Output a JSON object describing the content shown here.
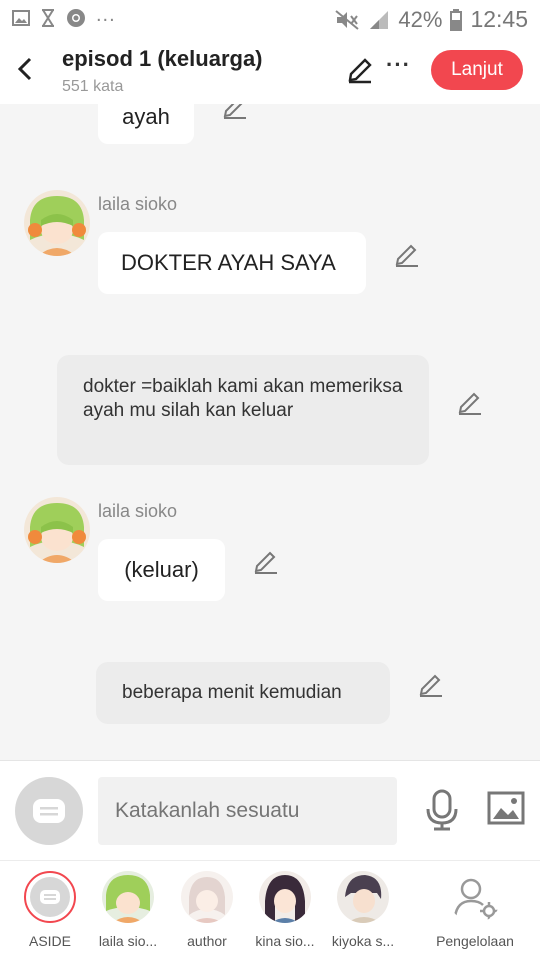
{
  "status_bar": {
    "battery": "42%",
    "time": "12:45",
    "more": "..."
  },
  "header": {
    "title": "episod 1 (keluarga)",
    "subtitle": "551 kata",
    "more": "···",
    "next_label": "Lanjut"
  },
  "messages": [
    {
      "type": "bubble",
      "text": "ayah"
    },
    {
      "type": "character",
      "name": "laila sioko",
      "text": "DOKTER AYAH SAYA"
    },
    {
      "type": "narration",
      "text": "dokter =baiklah kami akan memeriksa ayah mu silah kan keluar"
    },
    {
      "type": "character",
      "name": "laila sioko",
      "text": "(keluar)"
    },
    {
      "type": "narration",
      "text": "beberapa menit kemudian"
    }
  ],
  "input": {
    "placeholder": "Katakanlah sesuatu"
  },
  "cast": [
    {
      "label": "ASIDE"
    },
    {
      "label": "laila sio..."
    },
    {
      "label": "author"
    },
    {
      "label": "kina sio..."
    },
    {
      "label": "kiyoka s..."
    },
    {
      "label": "Pengelolaan"
    }
  ],
  "colors": {
    "accent": "#f2474f",
    "background": "#f5f5f5",
    "narration_bg": "#ececec"
  }
}
